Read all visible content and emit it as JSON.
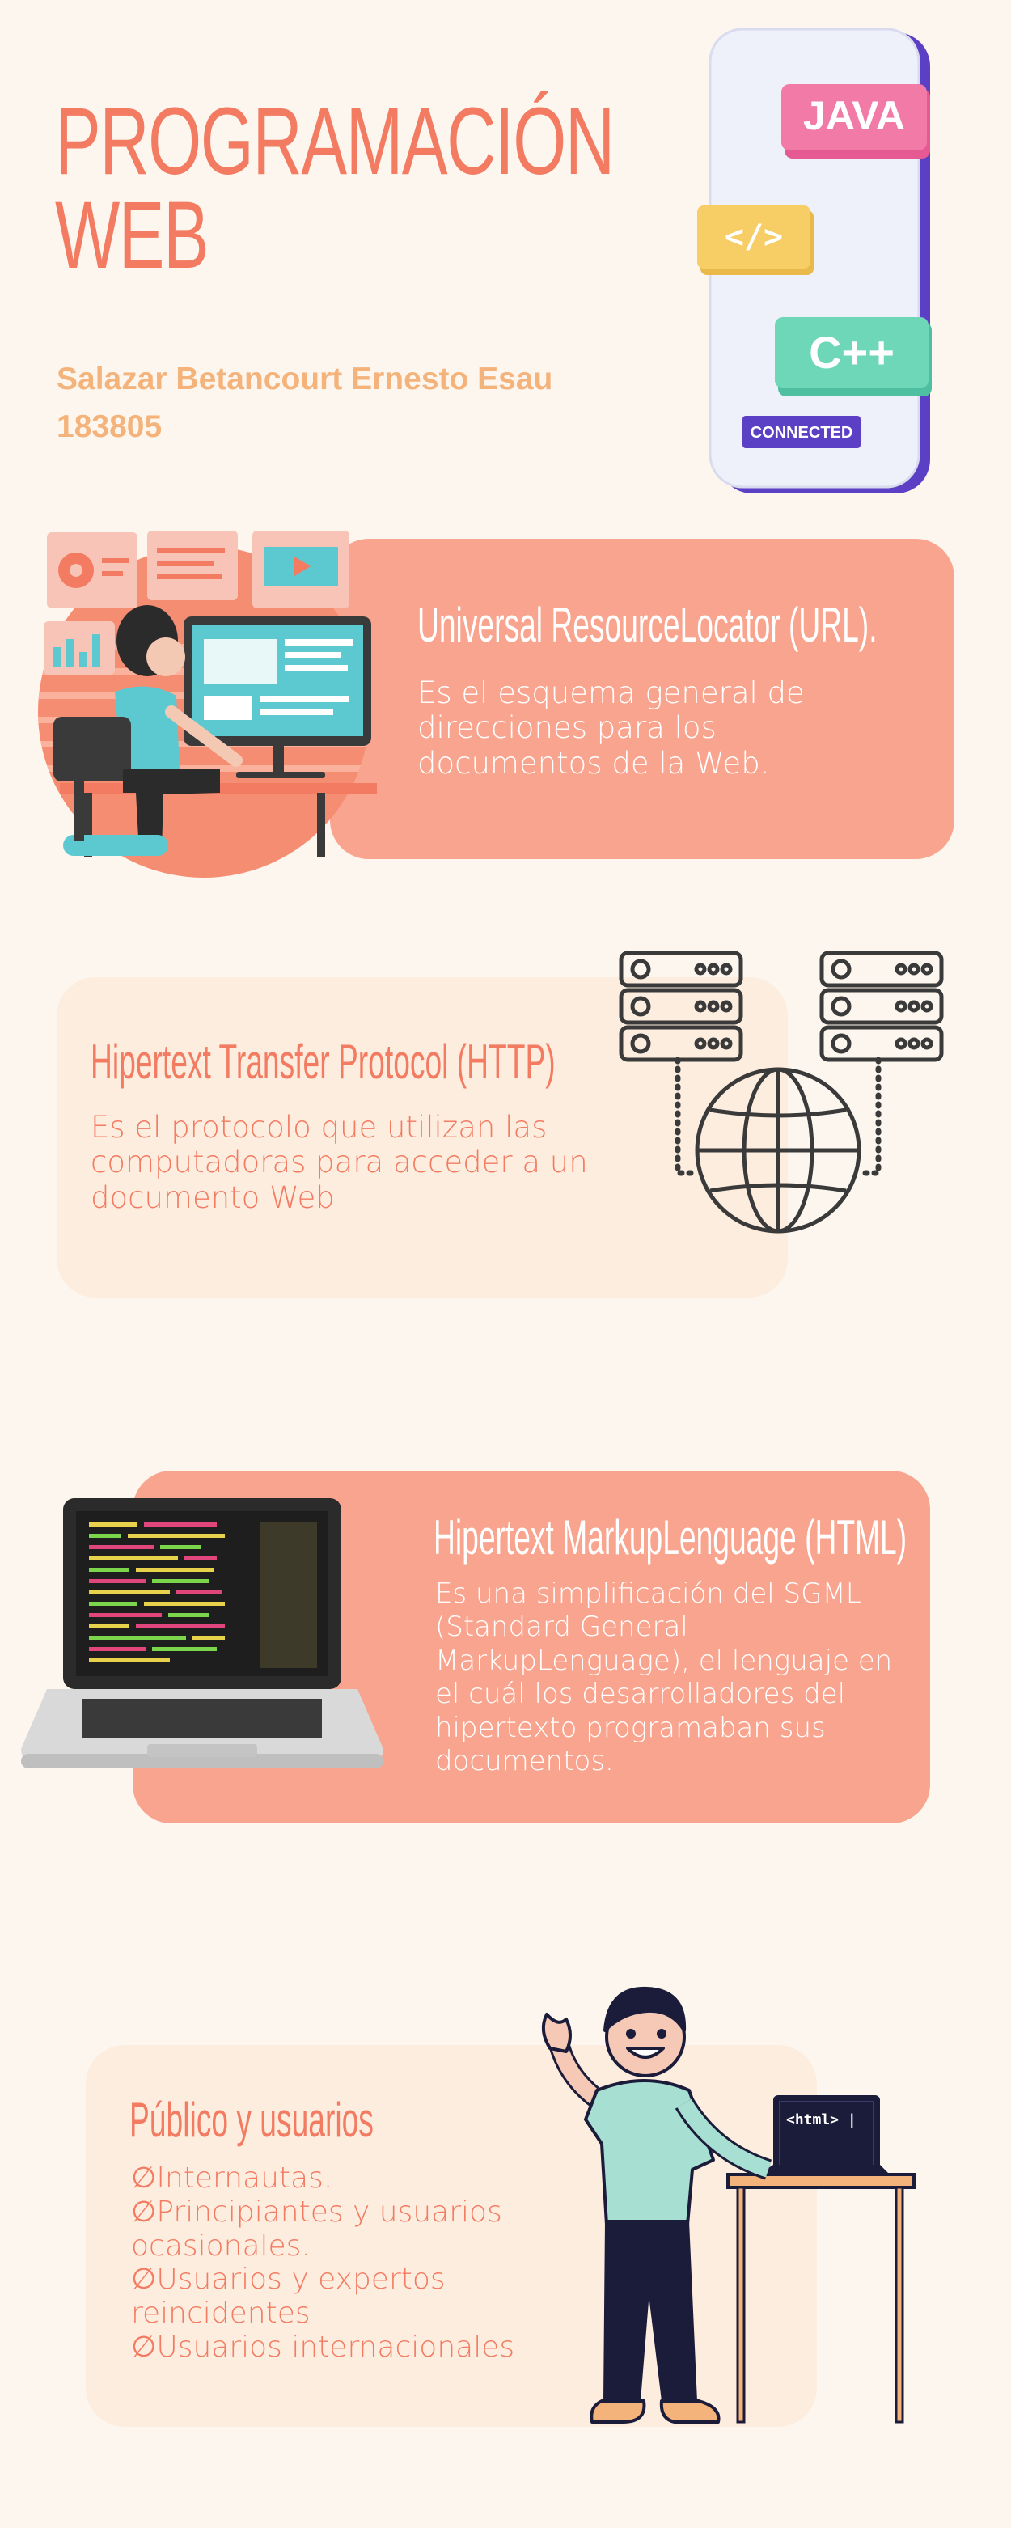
{
  "header": {
    "title_line1": "PROGRAMACIÓN",
    "title_line2": "WEB",
    "author": "Salazar Betancourt Ernesto Esau",
    "student_id": "183805"
  },
  "phone": {
    "badge_java": "JAVA",
    "badge_code": "</>",
    "badge_cpp": "C++",
    "badge_connected": "CONNECTED"
  },
  "sections": {
    "url": {
      "title": "Universal ResourceLocator (URL).",
      "body": "Es el esquema general de direcciones para los documentos de la Web."
    },
    "http": {
      "title": "Hipertext Transfer Protocol (HTTP)",
      "body": "Es el protocolo que utilizan las computadoras para acceder a un documento Web"
    },
    "html": {
      "title": "Hipertext MarkupLenguage (HTML)",
      "body": "Es una simplificación del SGML (Standard General MarkupLenguage), el lenguaje en el cuál los desarrolladores del hipertexto programaban sus documentos."
    },
    "audience": {
      "title": "Público y usuarios",
      "items": [
        "∅Internautas.",
        "∅Principiantes y usuarios ocasionales.",
        "∅Usuarios y expertos reincidentes",
        "∅Usuarios internacionales"
      ]
    }
  },
  "laptop_screen_text": "<html> |",
  "colors": {
    "background": "#fdf6ef",
    "coral": "#f27b62",
    "salmon_card": "#f9a48e",
    "cream_card": "#fdeddf",
    "author_orange": "#f4b37a"
  }
}
